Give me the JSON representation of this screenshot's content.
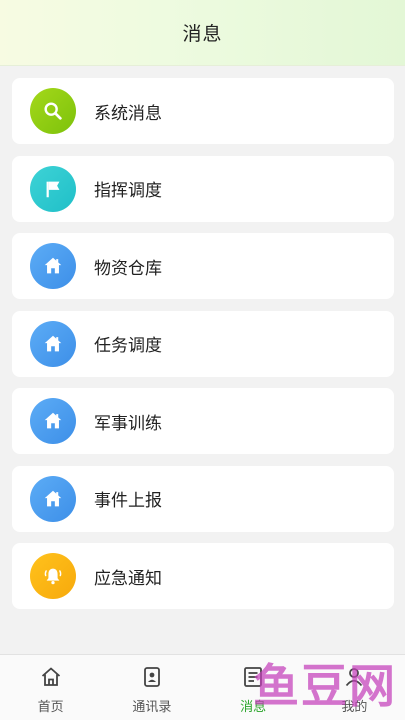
{
  "header": {
    "title": "消息"
  },
  "menu": {
    "items": [
      {
        "label": "系统消息",
        "icon": "search-icon",
        "color": "#8cc514"
      },
      {
        "label": "指挥调度",
        "icon": "flag-icon",
        "color": "#29c9cf"
      },
      {
        "label": "物资仓库",
        "icon": "home-icon",
        "color": "#4a9df0"
      },
      {
        "label": "任务调度",
        "icon": "home-icon",
        "color": "#4a9df0"
      },
      {
        "label": "军事训练",
        "icon": "home-icon",
        "color": "#4a9df0"
      },
      {
        "label": "事件上报",
        "icon": "home-icon",
        "color": "#4a9df0"
      },
      {
        "label": "应急通知",
        "icon": "bell-icon",
        "color": "#f9b312"
      }
    ]
  },
  "tabbar": {
    "tabs": [
      {
        "label": "首页",
        "icon": "home-outline-icon"
      },
      {
        "label": "通讯录",
        "icon": "contacts-icon"
      },
      {
        "label": "消息",
        "icon": "message-icon",
        "active": true
      },
      {
        "label": "我的",
        "icon": "user-icon"
      }
    ],
    "active_color": "#2aa52a"
  },
  "watermark": {
    "text": "鱼豆网"
  }
}
